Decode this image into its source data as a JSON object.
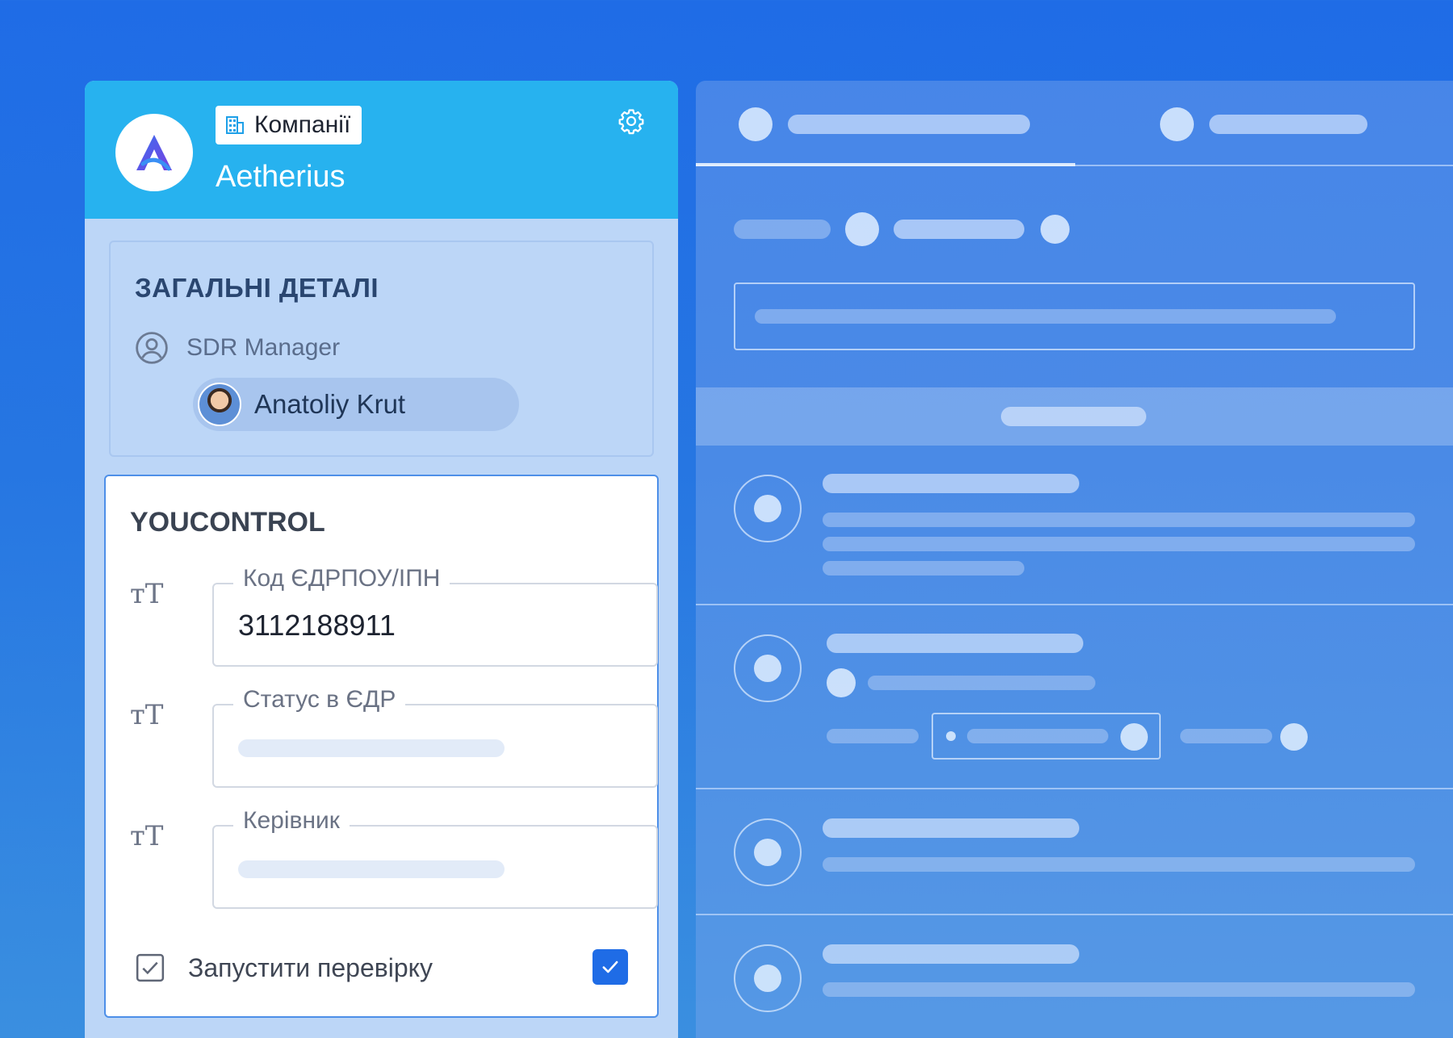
{
  "header": {
    "tag_label": "Компанії",
    "company_name": "Aetherius"
  },
  "general": {
    "title": "ЗАГАЛЬНІ ДЕТАЛІ",
    "sdr_label": "SDR Manager",
    "user_name": "Anatoliy Krut"
  },
  "youcontrol": {
    "title": "YOUCONTROL",
    "fields": [
      {
        "label": "Код ЄДРПОУ/ІПН",
        "value": "3112188911"
      },
      {
        "label": "Статус в ЄДР",
        "value": ""
      },
      {
        "label": "Керівник",
        "value": ""
      }
    ],
    "check_label": "Запустити перевірку",
    "checked": true
  },
  "colors": {
    "accent": "#1f6ce6",
    "header_bg": "#27b2ef",
    "panel_bg": "#bcd6f7"
  },
  "icons": [
    "building-icon",
    "gear-icon",
    "user-circle-icon",
    "text-type-icon",
    "checkbox-icon",
    "check-icon"
  ]
}
